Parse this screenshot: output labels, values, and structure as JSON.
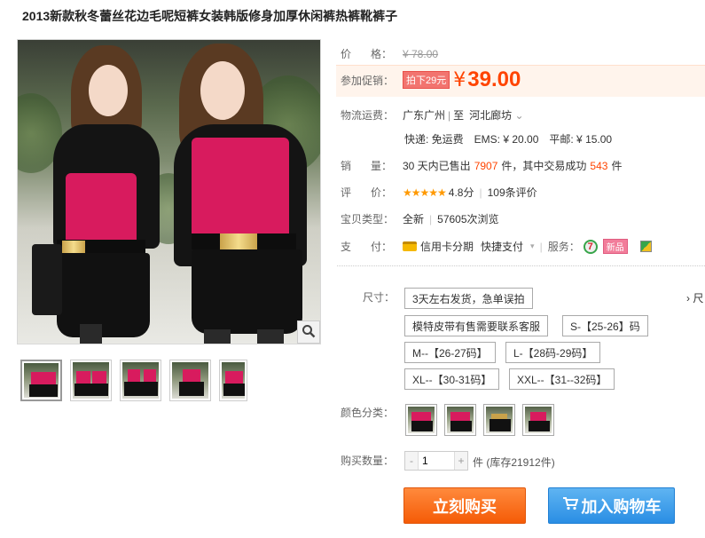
{
  "title": "2013新款秋冬蕾丝花边毛呢短裤女装韩版修身加厚休闲裤热裤靴裤子",
  "price": {
    "label": "价 格：",
    "label_a": "价",
    "label_b": "格：",
    "original": "¥ 78.00"
  },
  "promo": {
    "label": "参加促销：",
    "tag": "拍下29元",
    "currency": "¥",
    "price": "39.00"
  },
  "shipping": {
    "label": "物流运费：",
    "from": "广东广州",
    "to_prefix": "至",
    "to": "河北廊坊",
    "express": "快递: 免运费",
    "ems": "EMS: ¥ 20.00",
    "mail": "平邮: ¥ 15.00"
  },
  "sales": {
    "label_a": "销",
    "label_b": "量：",
    "prefix": "30 天内已售出",
    "count": "7907",
    "mid": "件，其中交易成功",
    "success": "543",
    "suffix": "件"
  },
  "rating": {
    "label_a": "评",
    "label_b": "价：",
    "stars": "★★★★★",
    "score": "4.8分",
    "reviews": "109条评价"
  },
  "type": {
    "label": "宝贝类型：",
    "value": "全新",
    "views": "57605次浏览"
  },
  "payment": {
    "label_a": "支",
    "label_b": "付：",
    "installment": "信用卡分期",
    "quick": "快捷支付",
    "service_label": "服务：",
    "badge7": "7",
    "new_badge": "新品"
  },
  "sizes": {
    "label": "尺寸：",
    "more": "› 尺",
    "options": [
      "3天左右发货，急单误拍",
      "模特皮带有售需要联系客服",
      "S-【25-26】码",
      "M--【26-27码】",
      "L-【28码-29码】",
      "XL--【30-31码】",
      "XXL--【31--32码】"
    ]
  },
  "colors": {
    "label": "颜色分类："
  },
  "quantity": {
    "label": "购买数量：",
    "value": "1",
    "minus": "-",
    "plus": "+",
    "stock": "件 (库存21912件)"
  },
  "buttons": {
    "buy": "立刻购买",
    "cart": "加入购物车"
  },
  "icons": {
    "zoom": "magnifier-icon",
    "cart": "cart-icon",
    "card": "card-icon"
  },
  "colors_theme": {
    "accent": "#ff4400",
    "buy": "#f55b07",
    "cart": "#2a8ee4",
    "star": "#ff9900"
  }
}
